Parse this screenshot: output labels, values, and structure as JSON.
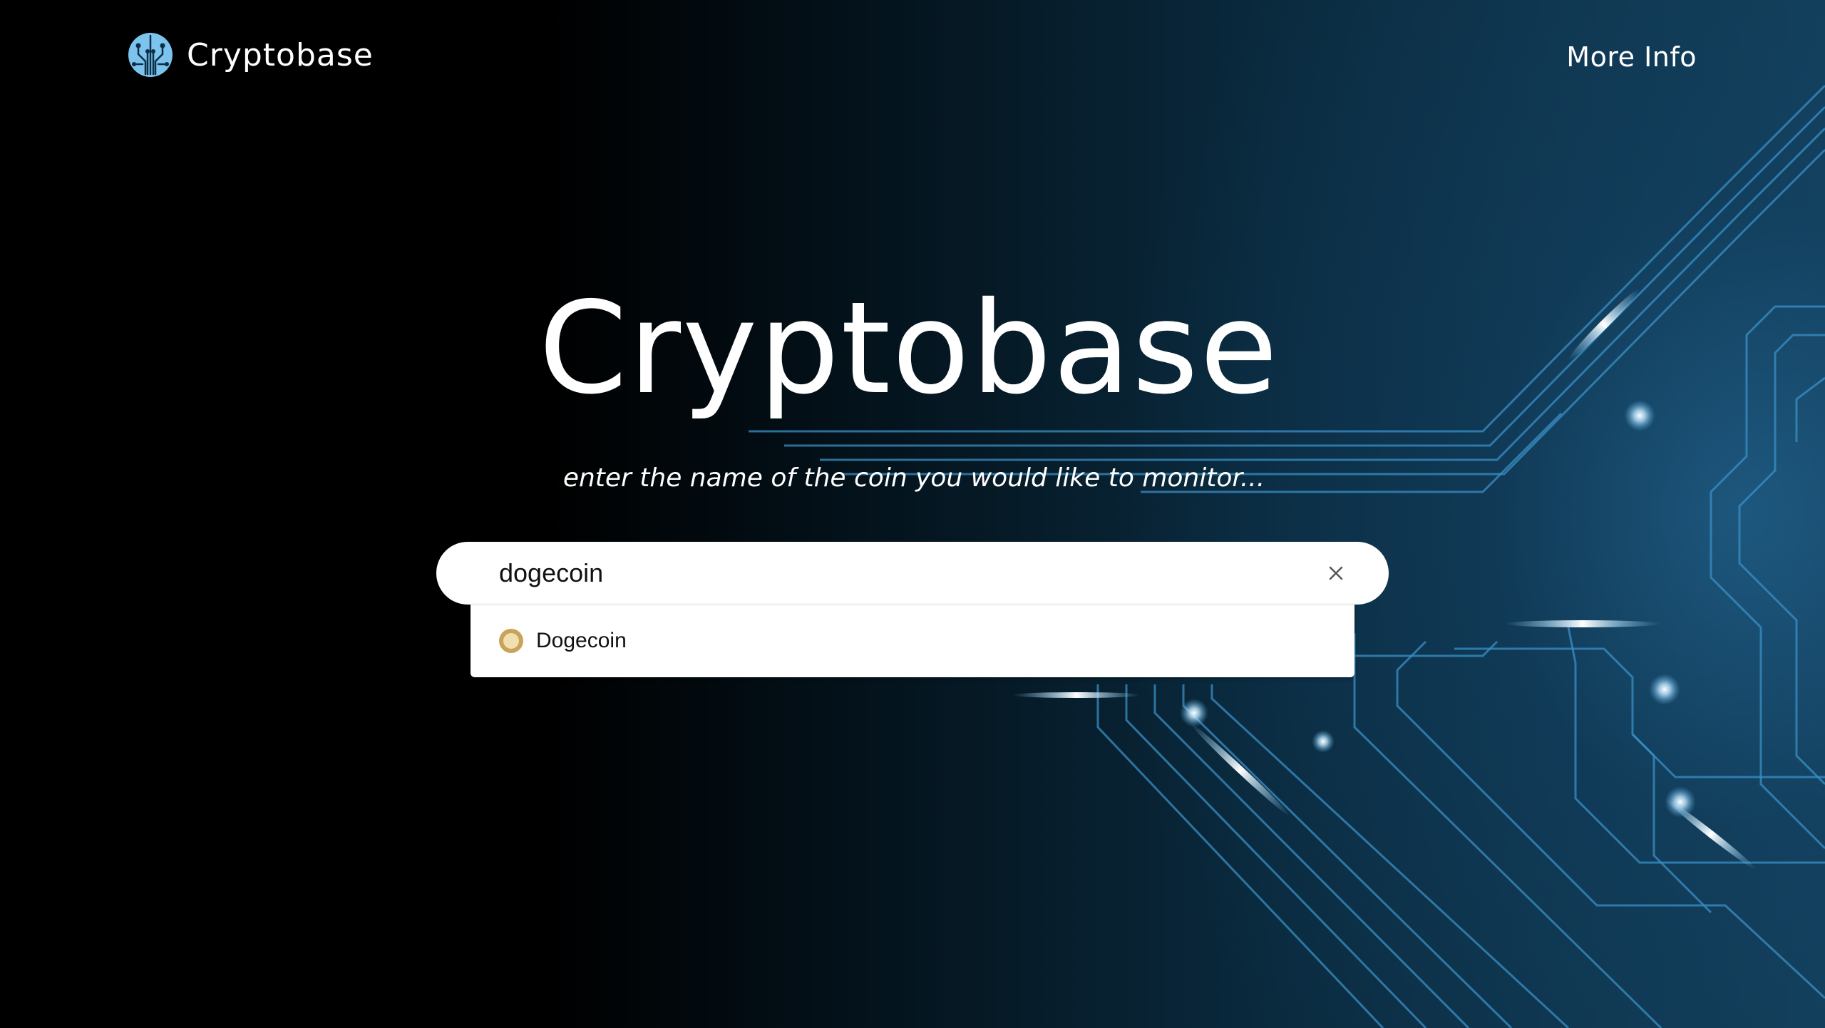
{
  "header": {
    "brand_name": "Cryptobase",
    "logo_icon": "circuit-brain-icon",
    "more_info_label": "More Info"
  },
  "hero": {
    "title": "Cryptobase",
    "subtitle": "enter the name of the coin you would like to monitor..."
  },
  "search": {
    "value": "dogecoin",
    "clear_icon": "close-icon",
    "suggestions": [
      {
        "label": "Dogecoin",
        "icon": "dogecoin-icon"
      }
    ]
  },
  "colors": {
    "background": "#000000",
    "accent_blue": "#4aa3d8",
    "logo_blue": "#7cc4ee",
    "text": "#ffffff"
  }
}
